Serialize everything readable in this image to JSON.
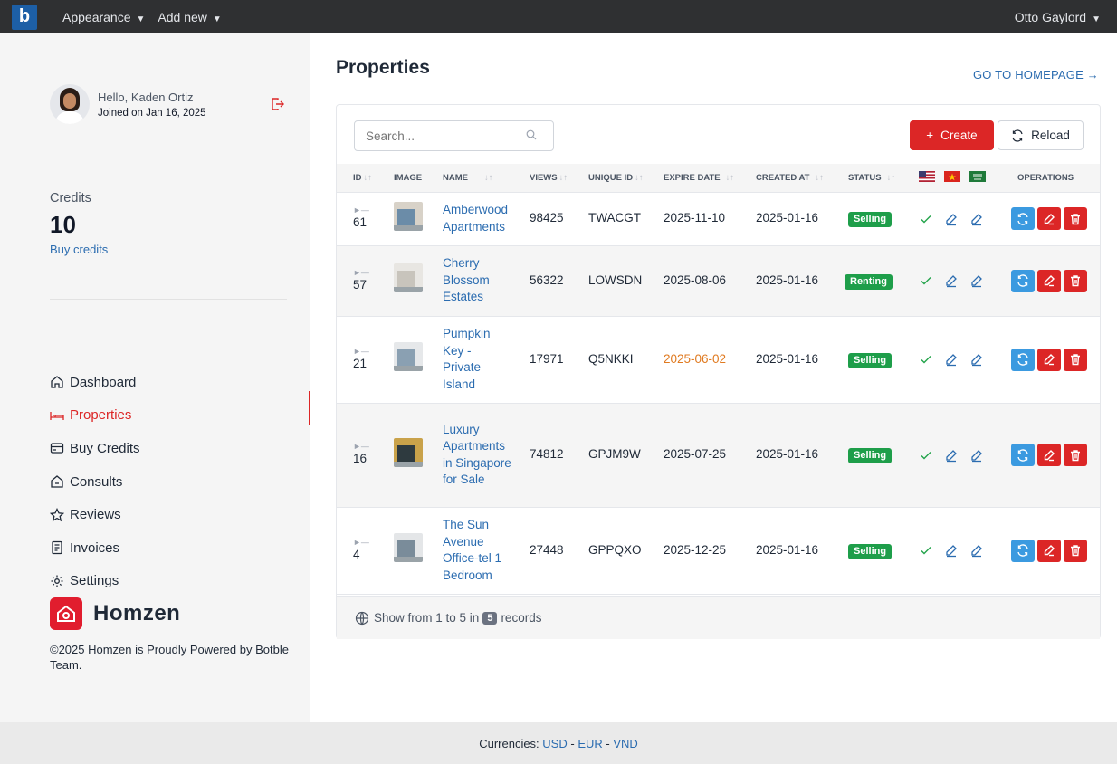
{
  "topbar": {
    "logo_letter": "b",
    "menu": [
      "Appearance",
      "Add new"
    ],
    "user": "Otto Gaylord"
  },
  "sidebar": {
    "hello": "Hello, Kaden Ortiz",
    "joined": "Joined on Jan 16, 2025",
    "credits_label": "Credits",
    "credits_value": "10",
    "buy_credits": "Buy credits",
    "nav": [
      {
        "label": "Dashboard",
        "icon": "home-icon"
      },
      {
        "label": "Properties",
        "icon": "bed-icon",
        "active": true
      },
      {
        "label": "Buy Credits",
        "icon": "credit-card-icon"
      },
      {
        "label": "Consults",
        "icon": "house-chat-icon"
      },
      {
        "label": "Reviews",
        "icon": "star-icon"
      },
      {
        "label": "Invoices",
        "icon": "receipt-icon"
      },
      {
        "label": "Settings",
        "icon": "gear-icon"
      }
    ],
    "brand": "Homzen",
    "copyright": "©2025 Homzen is Proudly Powered by Botble Team."
  },
  "main": {
    "title": "Properties",
    "homepage_link": "GO TO HOMEPAGE",
    "search_placeholder": "Search...",
    "create_label": "Create",
    "reload_label": "Reload",
    "columns": [
      "ID",
      "IMAGE",
      "NAME",
      "VIEWS",
      "UNIQUE ID",
      "EXPIRE DATE",
      "CREATED AT",
      "STATUS",
      "OPERATIONS"
    ],
    "rows": [
      {
        "id": "61",
        "name": "Amberwood Apartments",
        "views": "98425",
        "unique_id": "TWACGT",
        "expire": "2025-11-10",
        "created": "2025-01-16",
        "status": "Selling"
      },
      {
        "id": "57",
        "name": "Cherry Blossom Estates",
        "views": "56322",
        "unique_id": "LOWSDN",
        "expire": "2025-08-06",
        "created": "2025-01-16",
        "status": "Renting"
      },
      {
        "id": "21",
        "name": "Pumpkin Key - Private Island",
        "views": "17971",
        "unique_id": "Q5NKKI",
        "expire": "2025-06-02",
        "created": "2025-01-16",
        "status": "Selling"
      },
      {
        "id": "16",
        "name": "Luxury Apartments in Singapore for Sale",
        "views": "74812",
        "unique_id": "GPJM9W",
        "expire": "2025-07-25",
        "created": "2025-01-16",
        "status": "Selling"
      },
      {
        "id": "4",
        "name": "The Sun Avenue Office-tel 1 Bedroom",
        "views": "27448",
        "unique_id": "GPPQXO",
        "expire": "2025-12-25",
        "created": "2025-01-16",
        "status": "Selling"
      }
    ],
    "footer_prefix": "Show from 1 to 5 in",
    "footer_count": "5",
    "footer_suffix": "records"
  },
  "bottom": {
    "label": "Currencies:",
    "currencies": [
      "USD",
      "EUR",
      "VND"
    ],
    "separator": " - "
  },
  "colors": {
    "accent": "#dc2626",
    "link": "#2b6cb0",
    "badge": "#1e9e4a",
    "topbar": "#2f3032"
  }
}
